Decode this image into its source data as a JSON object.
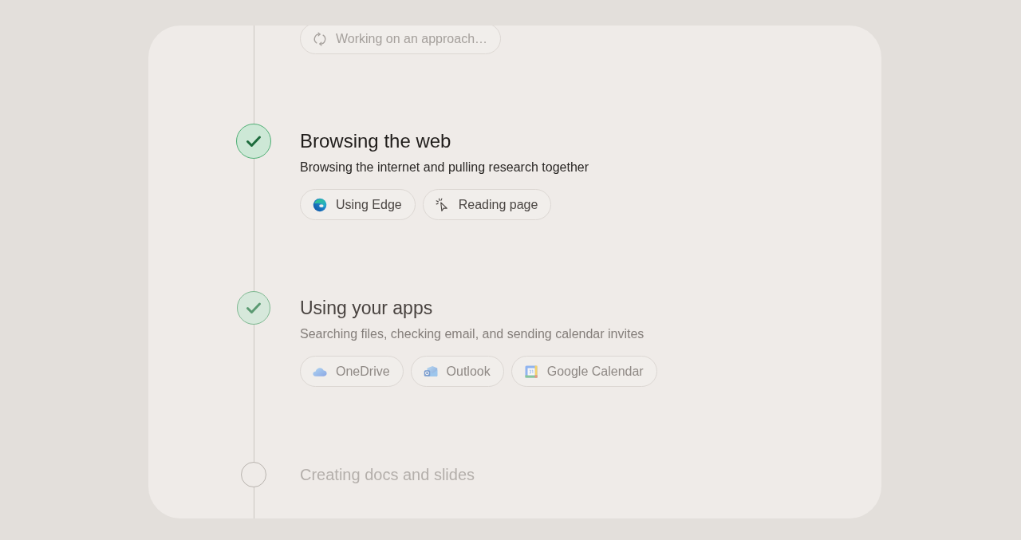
{
  "scrolled_step": {
    "chips": [
      {
        "kind": "spinner",
        "label": "Working on an approach…"
      }
    ]
  },
  "steps": [
    {
      "title": "Browsing the web",
      "description": "Browsing the internet and pulling research together",
      "done": true,
      "selected": true,
      "chips": [
        {
          "kind": "browser",
          "label": "Using Edge"
        },
        {
          "kind": "pointer",
          "label": "Reading page"
        }
      ]
    },
    {
      "title": "Using your apps",
      "description": "Searching files, checking email, and sending calendar invites",
      "done": true,
      "selected": false,
      "chips": [
        {
          "kind": "cloud",
          "label": "OneDrive"
        },
        {
          "kind": "mail",
          "label": "Outlook"
        },
        {
          "kind": "calendar",
          "label": "Google Calendar"
        }
      ]
    },
    {
      "title": "Creating docs and slides",
      "done": false,
      "selected": false
    }
  ]
}
